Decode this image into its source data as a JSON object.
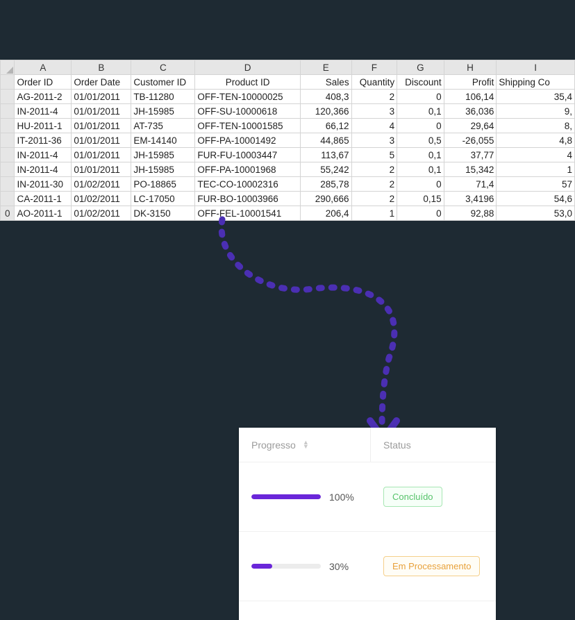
{
  "sheet": {
    "columns": [
      "A",
      "B",
      "C",
      "D",
      "E",
      "F",
      "G",
      "H",
      "I"
    ],
    "headers": [
      "Order ID",
      "Order Date",
      "Customer ID",
      "Product ID",
      "Sales",
      "Quantity",
      "Discount",
      "Profit",
      "Shipping Co"
    ],
    "rows": [
      {
        "cutoff": "",
        "a": "AG-2011-2",
        "b": "01/01/2011",
        "c": "TB-11280",
        "d": "OFF-TEN-10000025",
        "e": "408,3",
        "f": "2",
        "g": "0",
        "h": "106,14",
        "i": "35,4"
      },
      {
        "cutoff": "",
        "a": "IN-2011-4",
        "b": "01/01/2011",
        "c": "JH-15985",
        "d": "OFF-SU-10000618",
        "e": "120,366",
        "f": "3",
        "g": "0,1",
        "h": "36,036",
        "i": "9,"
      },
      {
        "cutoff": "",
        "a": "HU-2011-1",
        "b": "01/01/2011",
        "c": "AT-735",
        "d": "OFF-TEN-10001585",
        "e": "66,12",
        "f": "4",
        "g": "0",
        "h": "29,64",
        "i": "8,"
      },
      {
        "cutoff": "",
        "a": "IT-2011-36",
        "b": "01/01/2011",
        "c": "EM-14140",
        "d": "OFF-PA-10001492",
        "e": "44,865",
        "f": "3",
        "g": "0,5",
        "h": "-26,055",
        "i": "4,8"
      },
      {
        "cutoff": "",
        "a": "IN-2011-4",
        "b": "01/01/2011",
        "c": "JH-15985",
        "d": "FUR-FU-10003447",
        "e": "113,67",
        "f": "5",
        "g": "0,1",
        "h": "37,77",
        "i": "4"
      },
      {
        "cutoff": "",
        "a": "IN-2011-4",
        "b": "01/01/2011",
        "c": "JH-15985",
        "d": "OFF-PA-10001968",
        "e": "55,242",
        "f": "2",
        "g": "0,1",
        "h": "15,342",
        "i": "1"
      },
      {
        "cutoff": "",
        "a": "IN-2011-30",
        "b": "01/02/2011",
        "c": "PO-18865",
        "d": "TEC-CO-10002316",
        "e": "285,78",
        "f": "2",
        "g": "0",
        "h": "71,4",
        "i": "57"
      },
      {
        "cutoff": "",
        "a": "CA-2011-1",
        "b": "01/02/2011",
        "c": "LC-17050",
        "d": "FUR-BO-10003966",
        "e": "290,666",
        "f": "2",
        "g": "0,15",
        "h": "3,4196",
        "i": "54,6"
      },
      {
        "cutoff": "0",
        "a": "AO-2011-1",
        "b": "01/02/2011",
        "c": "DK-3150",
        "d": "OFF-FEL-10001541",
        "e": "206,4",
        "f": "1",
        "g": "0",
        "h": "92,88",
        "i": "53,0"
      }
    ]
  },
  "card": {
    "header": {
      "progress": "Progresso",
      "status": "Status"
    },
    "rows": [
      {
        "percent": 100,
        "percent_label": "100%",
        "status_label": "Concluído",
        "status_class": "green"
      },
      {
        "percent": 30,
        "percent_label": "30%",
        "status_label": "Em Processamento",
        "status_class": "yellow"
      }
    ]
  },
  "colors": {
    "accent": "#6a26d9"
  }
}
